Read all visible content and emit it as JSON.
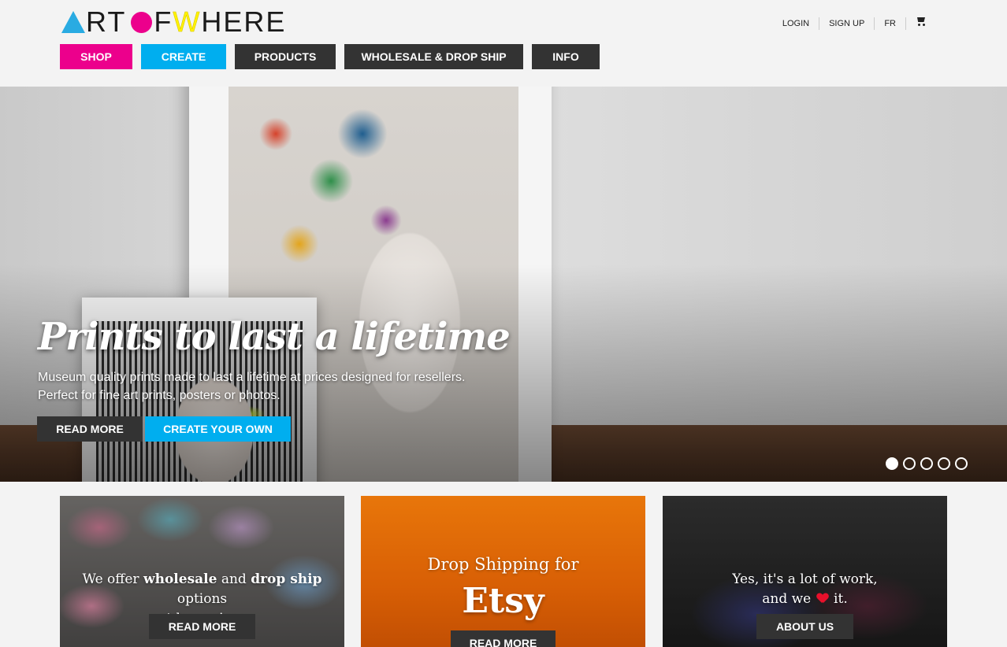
{
  "header": {
    "logo": {
      "part1": "RT",
      "part2": "F ",
      "part3": "W",
      "part4": "HERE"
    },
    "util": {
      "login": "LOGIN",
      "signup": "SIGN UP",
      "lang": "FR",
      "cart_icon": "cart-icon"
    },
    "nav": {
      "shop": "SHOP",
      "create": "CREATE",
      "products": "PRODUCTS",
      "wholesale": "WHOLESALE & DROP SHIP",
      "info": "INFO"
    },
    "colors": {
      "shop": "#ec008c",
      "create": "#00aeef",
      "dark": "#333333"
    }
  },
  "hero": {
    "title": "Prints to last a lifetime",
    "sub1": "Museum quality prints made to last a lifetime at prices designed for resellers.",
    "sub2": "Perfect for fine art prints, posters or photos.",
    "read_more": "READ MORE",
    "create_own": "CREATE YOUR OWN",
    "slides": 5,
    "active_slide": 1
  },
  "cards": {
    "wholesale": {
      "t1": "We offer ",
      "b1": "wholesale",
      "t2": " and ",
      "b2": "drop ship",
      "t3": " options",
      "line2": "at low prices",
      "button": "READ MORE"
    },
    "etsy": {
      "line1": "Drop Shipping for",
      "line2": "Etsy",
      "button": "READ MORE"
    },
    "about": {
      "line1": "Yes, it's a lot of work,",
      "line2a": "and we",
      "line2b": "it.",
      "heart_icon": "heart-icon",
      "button": "ABOUT US"
    }
  }
}
